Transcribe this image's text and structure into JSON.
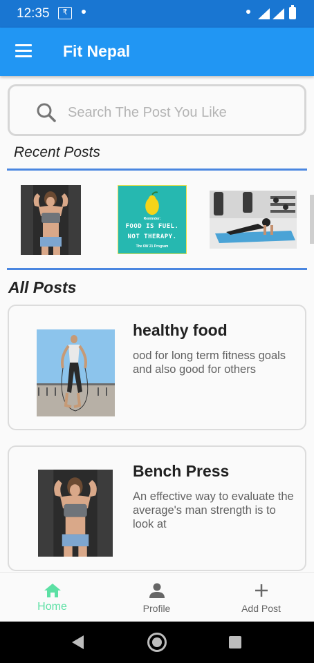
{
  "status_bar": {
    "time": "12:35",
    "currency_badge": "₹",
    "icons": [
      "rupee-badge-icon",
      "notification-dot-icon",
      "signal-icon",
      "signal-icon",
      "battery-icon"
    ]
  },
  "app_bar": {
    "title": "Fit Nepal",
    "menu_icon": "hamburger-menu-icon",
    "color": "#2196f3"
  },
  "search": {
    "placeholder": "Search The Post You Like",
    "value": "",
    "icon": "search-icon"
  },
  "recent_posts": {
    "title": "Recent Posts",
    "items": [
      {
        "image": "woman-flexing-gym-photo"
      },
      {
        "image": "food-is-fuel-quote-card",
        "reminder": "Reminder:",
        "line1": "FOOD IS FUEL.",
        "line2": "NOT THERAPY.",
        "footer": "The 6W 21 Program"
      },
      {
        "image": "woman-plank-gym-photo"
      },
      {
        "image": "partial-thumbnail"
      }
    ]
  },
  "all_posts": {
    "title": "All Posts",
    "items": [
      {
        "title": "healthy food",
        "description": "ood for long term fitness goals and also good for others",
        "image": "woman-jump-rope-photo"
      },
      {
        "title": "Bench Press",
        "description": "An effective way to evaluate the average's man strength is to look at",
        "image": "woman-flexing-gym-photo"
      }
    ]
  },
  "bottom_nav": {
    "items": [
      {
        "label": "Home",
        "icon": "home-icon",
        "active": true
      },
      {
        "label": "Profile",
        "icon": "person-icon",
        "active": false
      },
      {
        "label": "Add Post",
        "icon": "plus-icon",
        "active": false
      }
    ],
    "active_color": "#5ce0a4"
  },
  "system_nav": {
    "buttons": [
      "back-icon",
      "home-circle-icon",
      "recents-square-icon"
    ]
  }
}
